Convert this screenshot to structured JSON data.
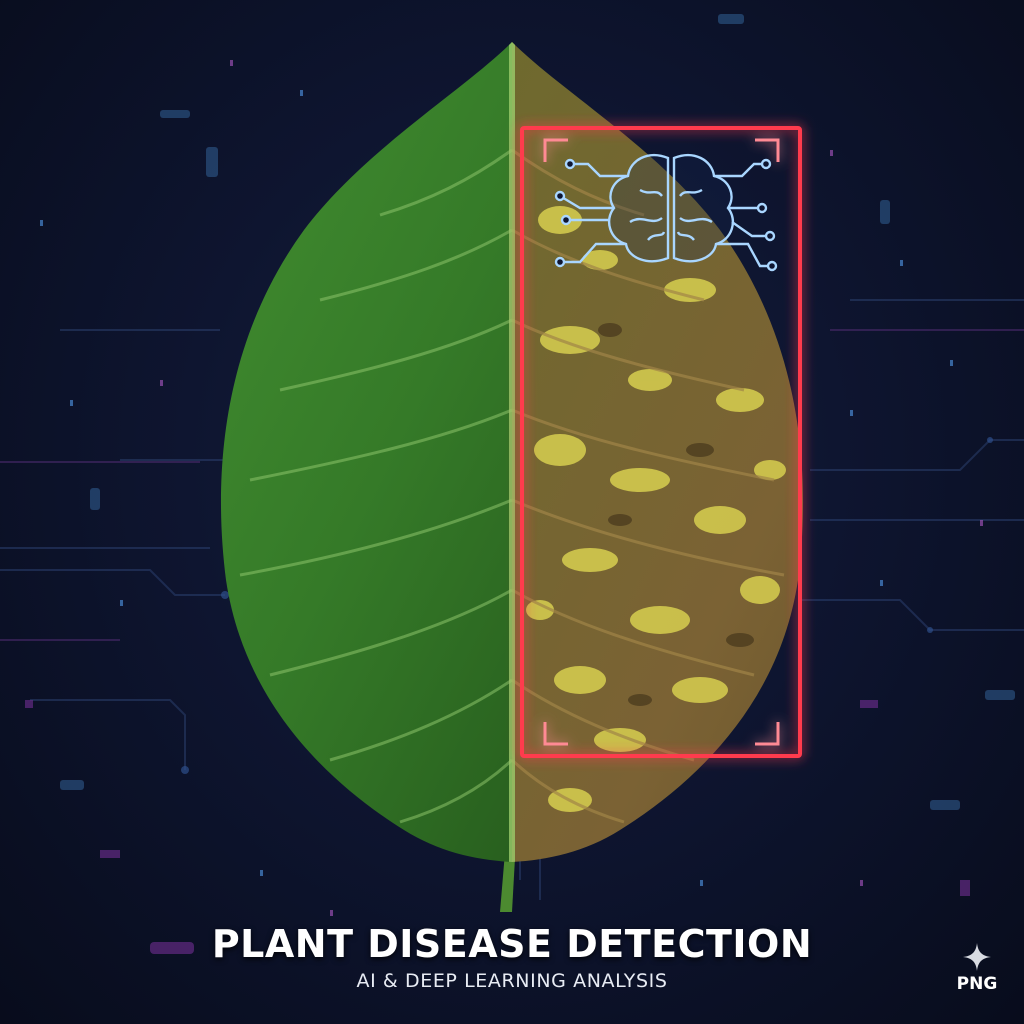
{
  "title": "PLANT DISEASE DETECTION",
  "subtitle": "AI & DEEP LEARNING ANALYSIS",
  "badge": {
    "label": "PNG",
    "icon": "sparkle-icon"
  },
  "icons": {
    "leaf": "leaf-icon",
    "brain": "brain-circuit-icon",
    "scan_frame": "scan-frame-icon"
  },
  "colors": {
    "background": "#0b1124",
    "healthy_leaf": "#3f8a2f",
    "diseased_leaf": "#7a6432",
    "disease_spots": "#d4cc52",
    "scan_frame": "#ff3b4e",
    "brain_lines": "#9fd0ff",
    "title_text": "#ffffff"
  }
}
